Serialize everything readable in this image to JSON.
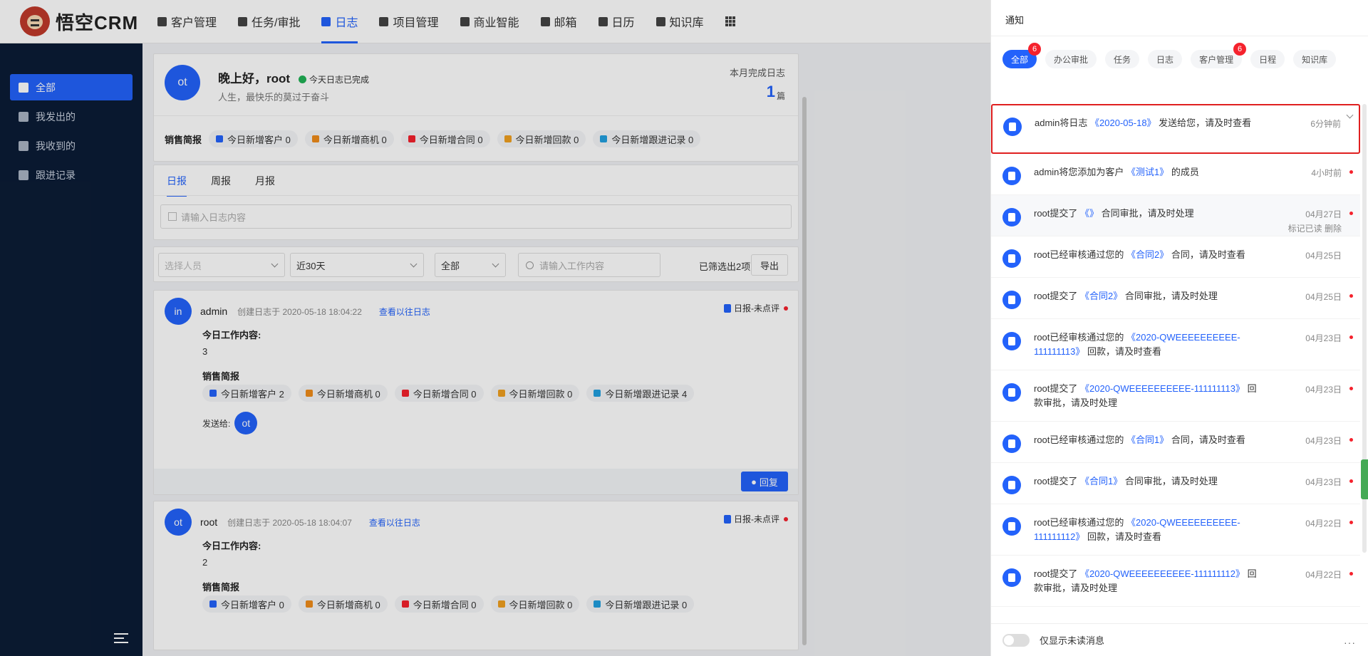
{
  "brand": {
    "name": "悟空CRM"
  },
  "nav": [
    {
      "label": "客户管理",
      "icon": "customer-icon",
      "active": false
    },
    {
      "label": "任务/审批",
      "icon": "task-icon",
      "active": false
    },
    {
      "label": "日志",
      "icon": "log-icon",
      "active": true
    },
    {
      "label": "项目管理",
      "icon": "project-icon",
      "active": false
    },
    {
      "label": "商业智能",
      "icon": "bi-icon",
      "active": false
    },
    {
      "label": "邮箱",
      "icon": "mail-icon",
      "active": false
    },
    {
      "label": "日历",
      "icon": "calendar-icon",
      "active": false
    },
    {
      "label": "知识库",
      "icon": "knowledge-icon",
      "active": false
    }
  ],
  "sidebar": {
    "items": [
      {
        "label": "全部",
        "icon": "grid-icon",
        "active": true
      },
      {
        "label": "我发出的",
        "icon": "send-icon",
        "active": false
      },
      {
        "label": "我收到的",
        "icon": "inbox-icon",
        "active": false
      },
      {
        "label": "跟进记录",
        "icon": "chat-icon",
        "active": false
      }
    ]
  },
  "summary": {
    "avatar": "ot",
    "greeting": "晚上好，root",
    "status": "今天日志已完成",
    "motto": "人生，最快乐的莫过于奋斗",
    "month_label": "本月完成日志",
    "month_value": "1",
    "month_unit": "篇",
    "sales_title": "销售简报",
    "sales": [
      {
        "label": "今日新增客户 0",
        "color": "#2362fb"
      },
      {
        "label": "今日新增商机 0",
        "color": "#f08c1b"
      },
      {
        "label": "今日新增合同 0",
        "color": "#f5222d"
      },
      {
        "label": "今日新增回款 0",
        "color": "#f0a020"
      },
      {
        "label": "今日新增跟进记录 0",
        "color": "#22a0e0"
      }
    ]
  },
  "tabs": [
    "日报",
    "周报",
    "月报"
  ],
  "log_input_placeholder": "请输入日志内容",
  "filters": {
    "person_placeholder": "选择人员",
    "range": "近30天",
    "type": "全部",
    "search_placeholder": "请输入工作内容",
    "count_text": "已筛选出2项",
    "export_label": "导出"
  },
  "logs": [
    {
      "avatar": "in",
      "name": "admin",
      "created": "创建日志于 2020-05-18 18:04:22",
      "link": "查看以往日志",
      "badge": "日报-未点评",
      "content_label": "今日工作内容:",
      "content": "3",
      "sales_title": "销售简报",
      "sales": [
        "今日新增客户 2",
        "今日新增商机 0",
        "今日新增合同 0",
        "今日新增回款 0",
        "今日新增跟进记录 4"
      ],
      "send_label": "发送给:",
      "send_avatar": "ot",
      "reply_label": "回复"
    },
    {
      "avatar": "ot",
      "name": "root",
      "created": "创建日志于 2020-05-18 18:04:07",
      "link": "查看以往日志",
      "badge": "日报-未点评",
      "content_label": "今日工作内容:",
      "content": "2",
      "sales_title": "销售简报",
      "sales": [
        "今日新增客户 0",
        "今日新增商机 0",
        "今日新增合同 0",
        "今日新增回款 0",
        "今日新增跟进记录 0"
      ]
    }
  ],
  "notify": {
    "title": "通知",
    "tabs": [
      {
        "label": "全部",
        "active": true,
        "badge": "6"
      },
      {
        "label": "办公审批",
        "active": false,
        "badge": ""
      },
      {
        "label": "任务",
        "active": false,
        "badge": ""
      },
      {
        "label": "日志",
        "active": false,
        "badge": ""
      },
      {
        "label": "客户管理",
        "active": false,
        "badge": "6"
      },
      {
        "label": "日程",
        "active": false,
        "badge": ""
      },
      {
        "label": "知识库",
        "active": false,
        "badge": ""
      }
    ],
    "items": [
      {
        "pre": "admin将日志",
        "hl": "《2020-05-18》",
        "post": "发送给您，请及时查看",
        "time": "6分钟前",
        "unread": false,
        "selected": true,
        "hover": false,
        "h": 70
      },
      {
        "pre": "admin将您添加为客户",
        "hl": "《测试1》",
        "post": "的成员",
        "time": "4小时前",
        "unread": true,
        "selected": false,
        "hover": false,
        "h": 58
      },
      {
        "pre": "root提交了",
        "hl": "《》",
        "post": "合同审批，请及时处理",
        "time": "04月27日",
        "unread": true,
        "selected": false,
        "hover": true,
        "h": 58,
        "actions": "标记已读  删除"
      },
      {
        "pre": "root已经审核通过您的",
        "hl": "《合同2》",
        "post": "合同，请及时查看",
        "time": "04月25日",
        "unread": false,
        "selected": false,
        "hover": false,
        "h": 58
      },
      {
        "pre": "root提交了",
        "hl": "《合同2》",
        "post": "合同审批，请及时处理",
        "time": "04月25日",
        "unread": true,
        "selected": false,
        "hover": false,
        "h": 58
      },
      {
        "pre": "root已经审核通过您的",
        "hl": "《2020-QWEEEEEEEEEE-111111113》",
        "post": "回款，请及时查看",
        "time": "04月23日",
        "unread": true,
        "selected": false,
        "hover": false,
        "h": 72
      },
      {
        "pre": "root提交了",
        "hl": "《2020-QWEEEEEEEEEE-111111113》",
        "post": "回款审批，请及时处理",
        "time": "04月23日",
        "unread": true,
        "selected": false,
        "hover": false,
        "h": 72
      },
      {
        "pre": "root已经审核通过您的",
        "hl": "《合同1》",
        "post": "合同，请及时查看",
        "time": "04月23日",
        "unread": true,
        "selected": false,
        "hover": false,
        "h": 58
      },
      {
        "pre": "root提交了",
        "hl": "《合同1》",
        "post": "合同审批，请及时处理",
        "time": "04月23日",
        "unread": true,
        "selected": false,
        "hover": false,
        "h": 58
      },
      {
        "pre": "root已经审核通过您的",
        "hl": "《2020-QWEEEEEEEEEE-111111112》",
        "post": "回款，请及时查看",
        "time": "04月22日",
        "unread": true,
        "selected": false,
        "hover": false,
        "h": 72
      },
      {
        "pre": "root提交了",
        "hl": "《2020-QWEEEEEEEEEE-111111112》",
        "post": "回款审批，请及时处理",
        "time": "04月22日",
        "unread": true,
        "selected": false,
        "hover": false,
        "h": 72
      }
    ],
    "footer": "仅显示未读消息",
    "more": "···"
  }
}
